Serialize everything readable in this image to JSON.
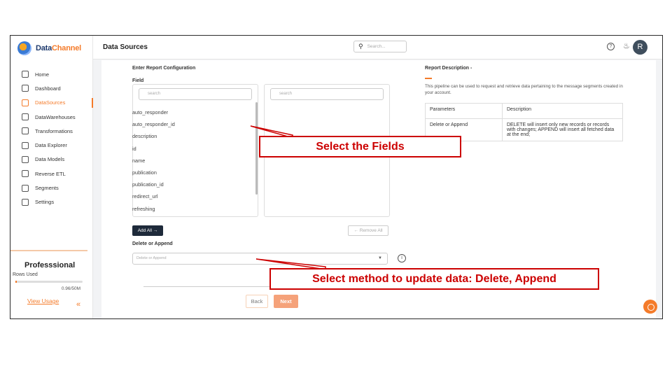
{
  "app": {
    "logo_text_a": "Data",
    "logo_text_b": "Channel"
  },
  "header": {
    "title": "Data Sources",
    "search_placeholder": "Search...",
    "avatar_initial": "R"
  },
  "sidebar": {
    "items": [
      {
        "label": "Home",
        "icon": "home-icon"
      },
      {
        "label": "Dashboard",
        "icon": "dashboard-icon"
      },
      {
        "label": "DataSources",
        "icon": "datasources-icon",
        "active": true
      },
      {
        "label": "DataWarehouses",
        "icon": "warehouse-icon"
      },
      {
        "label": "Transformations",
        "icon": "transform-icon"
      },
      {
        "label": "Data Explorer",
        "icon": "explorer-icon"
      },
      {
        "label": "Data Models",
        "icon": "models-icon"
      },
      {
        "label": "Reverse ETL",
        "icon": "reverse-etl-icon"
      },
      {
        "label": "Segments",
        "icon": "segments-icon"
      },
      {
        "label": "Settings",
        "icon": "settings-icon"
      }
    ],
    "plan": {
      "title": "Professsional",
      "rows_label": "Rows Used",
      "rows_count": "0.96/50M",
      "rows_fraction": 0.02,
      "link": "View Usage"
    },
    "collapse": "«"
  },
  "config": {
    "heading": "Enter Report Configuration",
    "field_label": "Field",
    "left_search_placeholder": "search",
    "right_search_placeholder": "search",
    "fields": [
      "auto_responder",
      "auto_responder_id",
      "description",
      "id",
      "name",
      "publication",
      "publication_id",
      "redirect_url",
      "refreshing"
    ],
    "add_all": "Add All →",
    "remove_all": "← Remove All",
    "delete_append_label": "Delete or Append",
    "select_placeholder": "Delete or Append",
    "back": "Back",
    "next": "Next"
  },
  "description": {
    "heading": "Report Description -",
    "text": "This pipeline can be used to request and retrieve data pertaining to the message segments created in your account.",
    "table_headers": [
      "Parameters",
      "Description"
    ],
    "rows": [
      [
        "Delete or Append",
        "DELETE will insert only new records or records with changes; APPEND will insert all fetched data at the end;"
      ]
    ]
  },
  "callouts": {
    "fields": "Select the Fields",
    "method": "Select method to update data: Delete, Append"
  },
  "colors": {
    "accent": "#f47b2a",
    "callout": "#cc0000",
    "dark_button": "#1e2a3a"
  }
}
